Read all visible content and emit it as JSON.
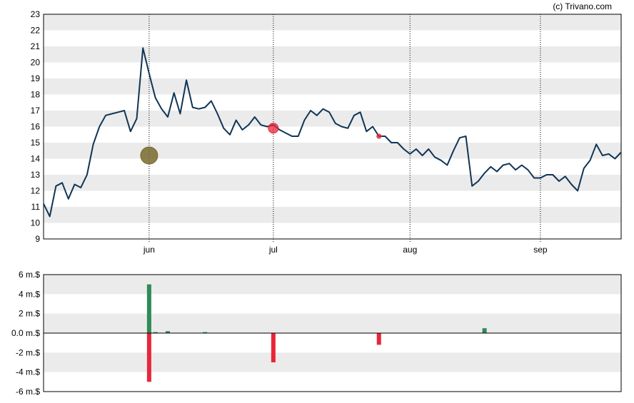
{
  "credit": "(c) Trivano.com",
  "colors": {
    "price_line": "#0f3557",
    "band": "#ebebeb",
    "buy": "#2e8b57",
    "sell": "#e8263a",
    "buy_marker": "#7a6a2e",
    "sell_marker": "#e8263a",
    "axis": "#000000"
  },
  "chart_data": [
    {
      "type": "line",
      "title": "",
      "xlabel": "",
      "ylabel": "",
      "ylim": [
        9,
        23
      ],
      "yticks": [
        "9",
        "10",
        "11",
        "12",
        "13",
        "14",
        "15",
        "16",
        "17",
        "18",
        "19",
        "20",
        "21",
        "22",
        "23"
      ],
      "month_labels": [
        {
          "label": "jun",
          "index": 17
        },
        {
          "label": "jul",
          "index": 37
        },
        {
          "label": "aug",
          "index": 59
        },
        {
          "label": "sep",
          "index": 80
        }
      ],
      "grid": "alternating bands, dotted month lines",
      "series": [
        {
          "values": [
            11.2,
            10.4,
            12.3,
            12.5,
            11.5,
            12.4,
            12.2,
            13.0,
            14.9,
            16.0,
            16.7,
            16.8,
            16.9,
            17.0,
            15.7,
            16.5,
            20.9,
            19.3,
            17.8,
            17.1,
            16.6,
            18.1,
            16.8,
            18.9,
            17.2,
            17.1,
            17.2,
            17.6,
            16.8,
            15.9,
            15.5,
            16.4,
            15.8,
            16.1,
            16.6,
            16.1,
            16.0,
            16.1,
            15.8,
            15.6,
            15.4,
            15.4,
            16.4,
            17.0,
            16.7,
            17.1,
            16.9,
            16.2,
            16.0,
            15.9,
            16.7,
            16.9,
            15.7,
            16.0,
            15.4,
            15.4,
            15.0,
            15.0,
            14.6,
            14.3,
            14.6,
            14.2,
            14.6,
            14.1,
            13.9,
            13.6,
            14.5,
            15.3,
            15.4,
            12.3,
            12.6,
            13.1,
            13.5,
            13.2,
            13.6,
            13.7,
            13.3,
            13.6,
            13.3,
            12.8,
            12.8,
            13.0,
            13.0,
            12.6,
            12.9,
            12.4,
            12.0,
            13.4,
            13.9,
            14.9,
            14.2,
            14.3,
            14.0,
            14.4
          ]
        }
      ],
      "markers": [
        {
          "kind": "buy",
          "index": 17,
          "value": 14.2,
          "size": "large"
        },
        {
          "kind": "sell",
          "index": 37,
          "value": 15.9,
          "size": "medium"
        },
        {
          "kind": "sell",
          "index": 54,
          "value": 15.4,
          "size": "small"
        }
      ]
    },
    {
      "type": "bar",
      "title": "",
      "xlabel": "",
      "ylabel": "",
      "ylim": [
        -6,
        6
      ],
      "yticks": [
        "-6 m.$",
        "-4 m.$",
        "-2 m.$",
        "0.0 m.$",
        "2 m.$",
        "4 m.$",
        "6 m.$"
      ],
      "series": [
        {
          "name": "",
          "kind": "buy",
          "points": [
            {
              "index": 17,
              "value": 5.0
            },
            {
              "index": 18,
              "value": 0.1
            },
            {
              "index": 20,
              "value": 0.2
            },
            {
              "index": 26,
              "value": 0.1
            },
            {
              "index": 71,
              "value": 0.5
            }
          ]
        },
        {
          "name": "",
          "kind": "sell",
          "points": [
            {
              "index": 17,
              "value": -5.0
            },
            {
              "index": 37,
              "value": -3.0
            },
            {
              "index": 54,
              "value": -1.2
            }
          ]
        }
      ]
    }
  ]
}
